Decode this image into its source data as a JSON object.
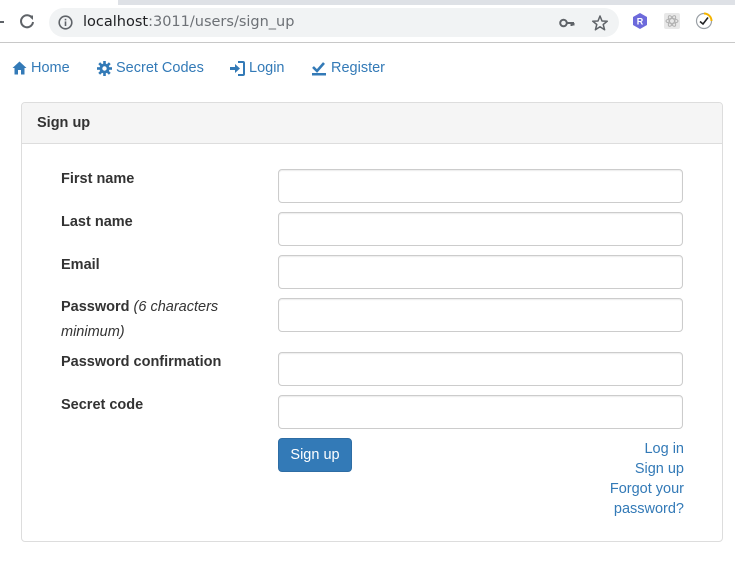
{
  "browser": {
    "url_host": "localhost",
    "url_rest": ":3011/users/sign_up",
    "extensions": [
      "redux-devtools-icon",
      "react-devtools-icon",
      "checker-extension-icon"
    ],
    "extension_r_letter": "R"
  },
  "nav": {
    "home": "Home",
    "secret_codes": "Secret Codes",
    "login": "Login",
    "register": "Register"
  },
  "panel": {
    "title": "Sign up"
  },
  "form": {
    "first_name_label": "First name",
    "last_name_label": "Last name",
    "email_label": "Email",
    "password_label": "Password",
    "password_hint": "(6 characters minimum)",
    "password_confirmation_label": "Password confirmation",
    "secret_code_label": "Secret code",
    "first_name_value": "",
    "last_name_value": "",
    "email_value": "",
    "password_value": "",
    "password_confirmation_value": "",
    "secret_code_value": "",
    "submit_label": "Sign up"
  },
  "links": {
    "log_in": "Log in",
    "sign_up": "Sign up",
    "forgot_password": "Forgot your password?"
  },
  "colors": {
    "link": "#337ab7",
    "primary_button": "#337ab7",
    "panel_heading_bg": "#f5f5f5",
    "panel_border": "#dddddd"
  }
}
